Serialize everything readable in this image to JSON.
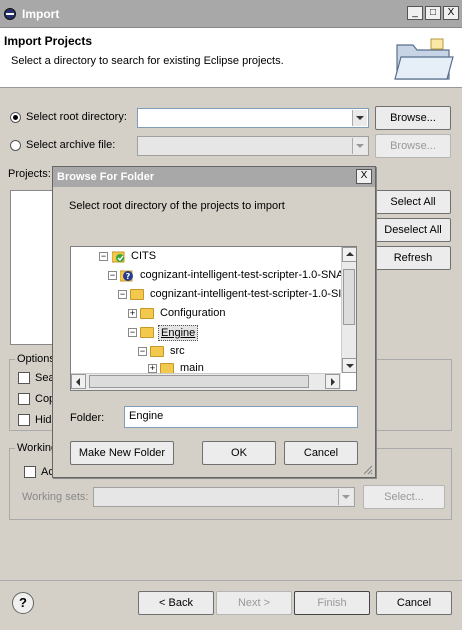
{
  "window": {
    "title": "Import",
    "minimize": "_",
    "maximize": "□",
    "close": "X"
  },
  "header": {
    "title": "Import Projects",
    "subtitle": "Select a directory to search for existing Eclipse projects."
  },
  "source": {
    "root_label": "Select root directory:",
    "archive_label": "Select archive file:",
    "browse_label": "Browse...",
    "browse_disabled_label": "Browse..."
  },
  "projects": {
    "label": "Projects:",
    "select_all": "Select All",
    "deselect_all": "Deselect All",
    "refresh": "Refresh"
  },
  "options": {
    "group_label": "Options",
    "items": [
      "Sea",
      "Cop",
      "Hid"
    ]
  },
  "working_sets": {
    "group_label": "Working",
    "add_label": "Ac",
    "sets_label": "Working sets:",
    "select_label": "Select..."
  },
  "footer": {
    "back": "< Back",
    "next": "Next >",
    "finish": "Finish",
    "cancel": "Cancel",
    "help": "?"
  },
  "browse_dialog": {
    "title": "Browse For Folder",
    "close": "X",
    "prompt": "Select root directory of the projects to import",
    "tree": [
      {
        "label": "CITS",
        "expander": "−"
      },
      {
        "label": "cognizant-intelligent-test-scripter-1.0-SNA",
        "expander": "−"
      },
      {
        "label": "cognizant-intelligent-test-scripter-1.0-SI",
        "expander": "−"
      },
      {
        "label": "Configuration",
        "expander": "+"
      },
      {
        "label": "Engine",
        "expander": "−"
      },
      {
        "label": "src",
        "expander": "−"
      },
      {
        "label": "main",
        "expander": "+"
      }
    ],
    "folder_label": "Folder:",
    "folder_value": "Engine",
    "make_new_folder": "Make New Folder",
    "ok": "OK",
    "cancel": "Cancel"
  },
  "colors": {
    "title_bar": "#a8a8a8",
    "dialog_bg": "#d4d0c8",
    "folder": "#f2c94c",
    "input_border": "#7f9db9"
  }
}
